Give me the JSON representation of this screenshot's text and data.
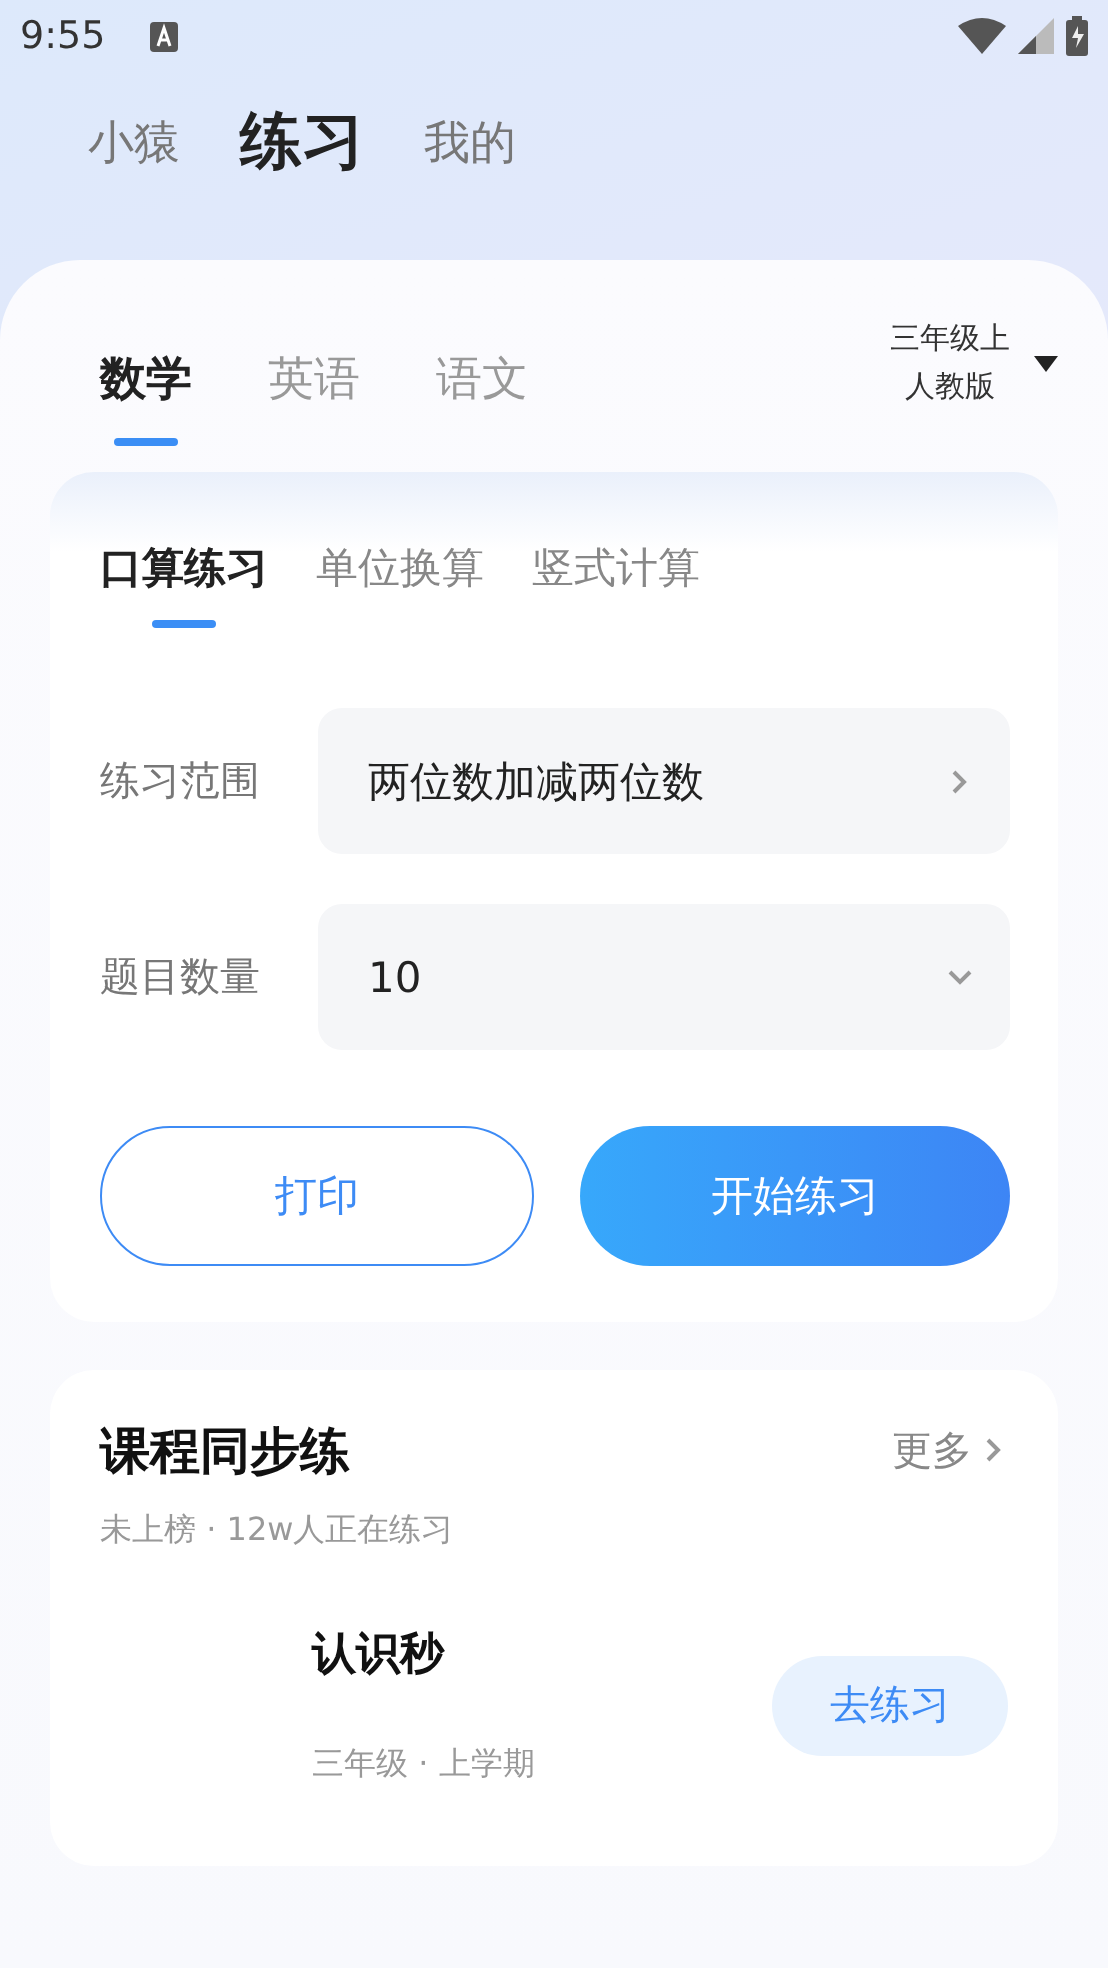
{
  "status_bar": {
    "time": "9:55"
  },
  "top_tabs": [
    {
      "label": "小猿",
      "selected": false
    },
    {
      "label": "练习",
      "selected": true
    },
    {
      "label": "我的",
      "selected": false
    }
  ],
  "subject_tabs": [
    {
      "label": "数学",
      "selected": true
    },
    {
      "label": "英语",
      "selected": false
    },
    {
      "label": "语文",
      "selected": false
    }
  ],
  "grade_selector": {
    "grade": "三年级上",
    "edition": "人教版"
  },
  "practice_tabs": [
    {
      "label": "口算练习",
      "selected": true
    },
    {
      "label": "单位换算",
      "selected": false
    },
    {
      "label": "竖式计算",
      "selected": false
    }
  ],
  "form_rows": [
    {
      "label": "练习范围",
      "value": "两位数加减两位数",
      "kind": "link"
    },
    {
      "label": "题目数量",
      "value": "10",
      "kind": "dropdown"
    }
  ],
  "buttons": [
    {
      "label": "打印",
      "kind": "outline"
    },
    {
      "label": "开始练习",
      "kind": "primary"
    }
  ],
  "course_card": {
    "title": "课程同步练",
    "more": "更多",
    "subtitle": "未上榜 · 12w人正在练习",
    "lesson": {
      "title": "认识秒",
      "meta": "三年级 · 上学期",
      "action": "去练习"
    }
  }
}
